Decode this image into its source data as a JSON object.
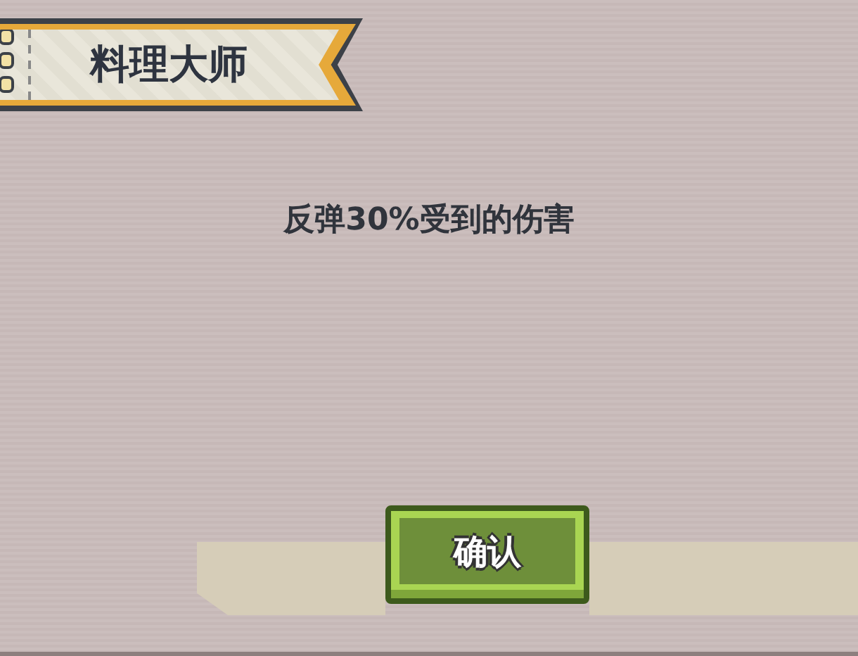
{
  "title": "料理大师",
  "description": "反弹30%受到的伤害",
  "buttons": [
    {
      "label": "确认"
    }
  ]
}
